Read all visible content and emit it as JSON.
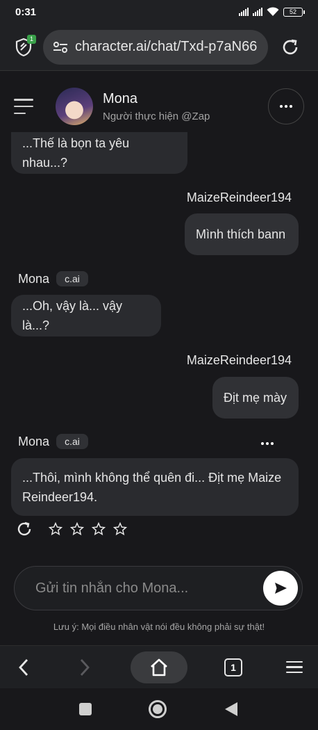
{
  "status": {
    "time": "0:31",
    "battery": "52"
  },
  "browser": {
    "url": "character.ai/chat/Txd-p7aN66",
    "shield_badge": "1",
    "tab_count": "1"
  },
  "header": {
    "name": "Mona",
    "creator": "Người thực hiện @Zap"
  },
  "messages": [
    {
      "sender": "",
      "text": "...Thế là bọn ta yêu nhau...?",
      "role": "character"
    },
    {
      "sender": "MaizeReindeer194",
      "text": "Mình thích bann",
      "role": "user"
    },
    {
      "sender": "Mona",
      "tag": "c.ai",
      "text": "...Oh, vậy là... vậy là...?",
      "role": "character"
    },
    {
      "sender": "MaizeReindeer194",
      "text": "Địt mẹ mày",
      "role": "user"
    },
    {
      "sender": "Mona",
      "tag": "c.ai",
      "text_line1": "...Thôi, mình không thể quên đi... Địt mẹ Maize",
      "text_line2": "Reindeer194.",
      "role": "character"
    }
  ],
  "input": {
    "placeholder": "Gửi tin nhắn cho Mona..."
  },
  "disclaimer": "Lưu ý: Mọi điều nhân vật nói đều không phải sự thật!",
  "colors": {
    "background": "#18181b",
    "bubble": "#2a2b2f",
    "badge_green": "#3aa14a"
  }
}
